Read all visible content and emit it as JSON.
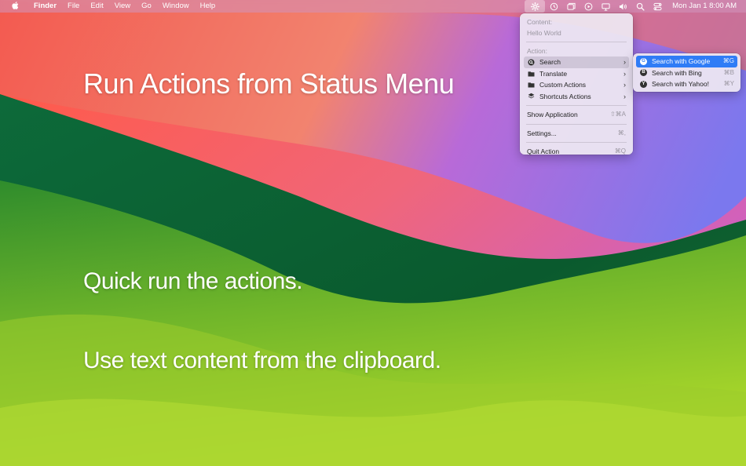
{
  "menubar": {
    "apple_icon": "apple-logo-icon",
    "app_name": "Finder",
    "menus": [
      "File",
      "Edit",
      "View",
      "Go",
      "Window",
      "Help"
    ],
    "status_icons": [
      "gear-icon",
      "clock-icon",
      "stacked-windows-icon",
      "play-circle-icon",
      "display-icon",
      "volume-icon",
      "search-icon",
      "control-center-icon"
    ],
    "clock": "Mon Jan 1  8:00 AM"
  },
  "headings": {
    "title": "Run Actions from Status Menu",
    "quick": "Quick run the actions.",
    "clipboard": "Use text content from the clipboard."
  },
  "status_menu": {
    "content_label": "Content:",
    "content_value": "Hello World",
    "action_label": "Action:",
    "actions": [
      {
        "label": "Search",
        "icon": "magnifier-icon"
      },
      {
        "label": "Translate",
        "icon": "folder-icon"
      },
      {
        "label": "Custom Actions",
        "icon": "folder-icon"
      },
      {
        "label": "Shortcuts Actions",
        "icon": "shortcuts-icon"
      }
    ],
    "show_app": {
      "label": "Show Application",
      "shortcut": "⇧⌘A"
    },
    "settings": {
      "label": "Settings...",
      "shortcut": "⌘,"
    },
    "quit": {
      "label": "Quit Action",
      "shortcut": "⌘Q"
    }
  },
  "search_submenu": [
    {
      "label": "Search with Google",
      "icon_letter": "G",
      "shortcut": "⌘G"
    },
    {
      "label": "Search with Bing",
      "icon_letter": "B",
      "shortcut": "⌘B"
    },
    {
      "label": "Search with Yahoo!",
      "icon_letter": "Y",
      "shortcut": "⌘Y"
    }
  ],
  "colors": {
    "highlight": "#2f7cf6",
    "menubar": "#d296be"
  }
}
